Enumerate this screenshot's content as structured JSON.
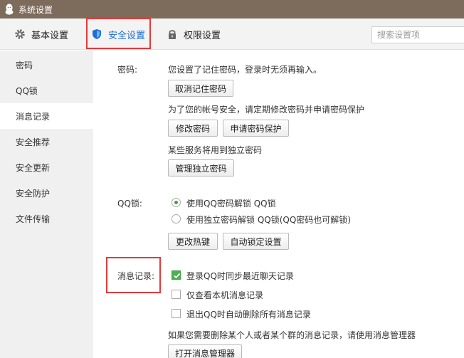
{
  "window": {
    "title": "系统设置",
    "logo_icon": "qq-penguin-icon"
  },
  "tabs": [
    {
      "label": "基本设置",
      "icon": "gear-icon"
    },
    {
      "label": "安全设置",
      "icon": "shield-icon",
      "active": true
    },
    {
      "label": "权限设置",
      "icon": "lock-icon"
    }
  ],
  "search": {
    "placeholder": "搜索设置项",
    "value": ""
  },
  "sidebar": {
    "items": [
      {
        "label": "密码"
      },
      {
        "label": "QQ锁"
      },
      {
        "label": "消息记录",
        "active": true
      },
      {
        "label": "安全推荐"
      },
      {
        "label": "安全更新"
      },
      {
        "label": "安全防护"
      },
      {
        "label": "文件传输"
      }
    ]
  },
  "password": {
    "label": "密码:",
    "remembered_text": "您设置了记住密码，登录时无须再输入。",
    "cancel_remember_button": "取消记住密码",
    "advice_text": "为了您的帐号安全，请定期修改密码并申请密码保护",
    "change_button": "修改密码",
    "protect_button": "申请密码保护",
    "independent_text": "某些服务将用到独立密码",
    "manage_independent_button": "管理独立密码"
  },
  "qqlock": {
    "label": "QQ锁:",
    "options": [
      {
        "label": "使用QQ密码解锁 QQ锁",
        "selected": true
      },
      {
        "label": "使用独立密码解锁 QQ锁(QQ密码也可解锁)",
        "selected": false
      }
    ],
    "hotkey_button": "更改热键",
    "autolock_button": "自动锁定设置"
  },
  "messages": {
    "label": "消息记录:",
    "options": [
      {
        "label": "登录QQ时同步最近聊天记录",
        "checked": true
      },
      {
        "label": "仅查看本机消息记录",
        "checked": false
      },
      {
        "label": "退出QQ时自动删除所有消息记录",
        "checked": false
      }
    ],
    "manager_hint": "如果您需要删除某个人或者某个群的消息记录，请使用消息管理器",
    "open_manager_button": "打开消息管理器"
  },
  "colors": {
    "titlebar": "#7d6b5c",
    "accent": "#1d6fd6",
    "highlight_box": "#e03b3b",
    "check_green": "#4caf50"
  }
}
